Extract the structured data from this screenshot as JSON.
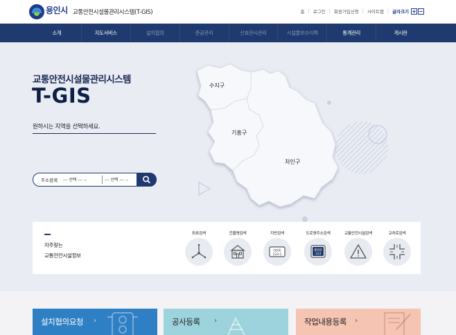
{
  "header": {
    "logo_text": "용인시",
    "site_title": "교통안전시설물관리시스템(T-GIS)",
    "utils": [
      "홈",
      "로그인",
      "회원가입신청",
      "사이트맵"
    ],
    "font_size_label": "글자크기",
    "font_plus": "+",
    "font_minus": "−"
  },
  "nav": {
    "items": [
      {
        "label": "소개",
        "enabled": true
      },
      {
        "label": "지도서비스",
        "enabled": true
      },
      {
        "label": "설치협의",
        "enabled": false
      },
      {
        "label": "준공관리",
        "enabled": false
      },
      {
        "label": "신호관시관리",
        "enabled": false
      },
      {
        "label": "시설물보수이력",
        "enabled": false
      },
      {
        "label": "통계관리",
        "enabled": true
      },
      {
        "label": "게시판",
        "enabled": true
      }
    ]
  },
  "hero": {
    "title": "교통안전시설물관리시스템",
    "big_title": "T-GIS",
    "subtitle": "원하시는 지역을 선택하세요."
  },
  "search": {
    "label": "주소검색",
    "select1": "--- 선택 ---",
    "select2": "--- 선택 ---"
  },
  "map": {
    "districts": [
      "수지구",
      "기흥구",
      "처인구"
    ]
  },
  "shortcuts": {
    "title_line1": "자주찾는",
    "title_line2": "교통안전시설정보",
    "items": [
      {
        "label": "좌표검색",
        "icon": "coordinate-icon"
      },
      {
        "label": "건물명검색",
        "icon": "building-icon"
      },
      {
        "label": "지번검색",
        "icon": "lot-number-icon",
        "inner": "OO동\n123-1"
      },
      {
        "label": "도로명주소검색",
        "icon": "road-address-icon",
        "inner": "중앙로\n123"
      },
      {
        "label": "교통안전시설검색",
        "icon": "warning-sign-icon"
      },
      {
        "label": "교차로검색",
        "icon": "intersection-icon"
      }
    ]
  },
  "cards": [
    {
      "label": "설치협의요청",
      "color": "#2f7fc4"
    },
    {
      "label": "공사등록",
      "color": "#9dd3dd"
    },
    {
      "label": "작업내용등록",
      "color": "#f6c4b2"
    }
  ],
  "colors": {
    "navy": "#1f3a6e",
    "hero_bg": "#e9ecf3",
    "map_fill": "#f7f8fb"
  }
}
